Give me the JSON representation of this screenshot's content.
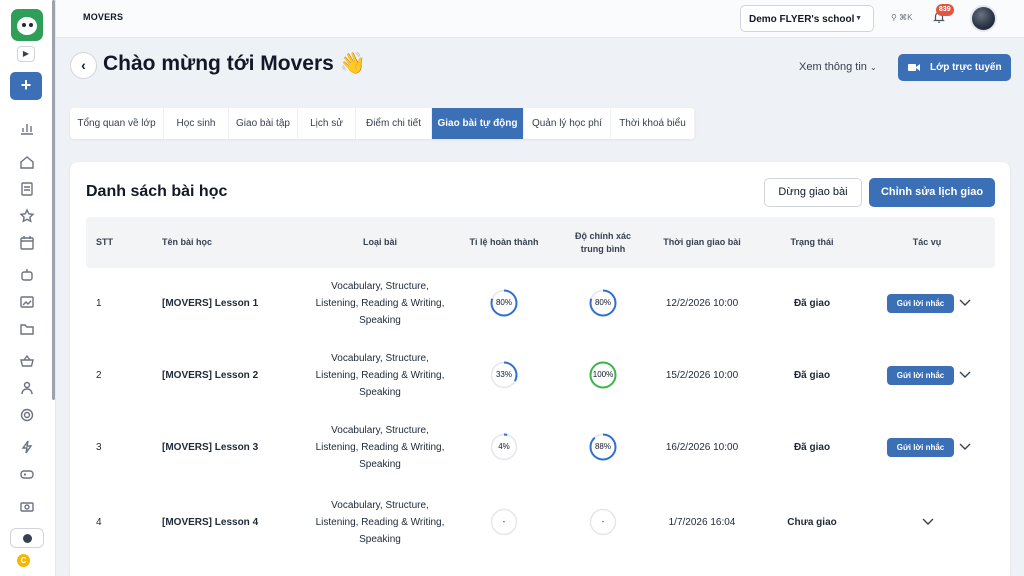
{
  "header": {
    "app_name": "MOVERS",
    "school": "Demo FLYER's school",
    "search_hint": "⌘K",
    "notification_count": "839"
  },
  "page": {
    "title": "Chào mừng tới Movers 👋",
    "info_link": "Xem thông tin",
    "online_class_button": "Lớp trực tuyến"
  },
  "tabs": [
    {
      "label": "Tổng quan về lớp",
      "active": false
    },
    {
      "label": "Học sinh",
      "active": false
    },
    {
      "label": "Giao bài tập",
      "active": false
    },
    {
      "label": "Lịch sử",
      "active": false
    },
    {
      "label": "Điểm chi tiết",
      "active": false
    },
    {
      "label": "Giao bài tự động",
      "active": true
    },
    {
      "label": "Quản lý học phí",
      "active": false
    },
    {
      "label": "Thời khoá biểu",
      "active": false
    }
  ],
  "lessons": {
    "title": "Danh sách bài học",
    "stop_button": "Dừng giao bài",
    "edit_button": "Chỉnh sửa lịch giao",
    "columns": [
      "STT",
      "Tên bài học",
      "Loại bài",
      "Tỉ lệ hoàn thành",
      "Độ chính xác trung bình",
      "Thời gian giao bài",
      "Trạng thái",
      "Tác vụ"
    ],
    "rows": [
      {
        "stt": "1",
        "name": "[MOVERS] Lesson 1",
        "type": "Vocabulary, Structure, Listening, Reading & Writing, Speaking",
        "completion": "80%",
        "completion_value": 0.8,
        "accuracy": "80%",
        "accuracy_value": 0.8,
        "time": "12/2/2026 10:00",
        "status": "Đã giao",
        "action": "Gửi lời nhắc"
      },
      {
        "stt": "2",
        "name": "[MOVERS] Lesson 2",
        "type": "Vocabulary, Structure, Listening, Reading & Writing, Speaking",
        "completion": "33%",
        "completion_value": 0.33,
        "accuracy": "100%",
        "accuracy_value": 1.0,
        "time": "15/2/2026 10:00",
        "status": "Đã giao",
        "action": "Gửi lời nhắc"
      },
      {
        "stt": "3",
        "name": "[MOVERS] Lesson 3",
        "type": "Vocabulary, Structure, Listening, Reading & Writing, Speaking",
        "completion": "4%",
        "completion_value": 0.04,
        "accuracy": "88%",
        "accuracy_value": 0.88,
        "time": "16/2/2026 10:00",
        "status": "Đã giao",
        "action": "Gửi lời nhắc"
      },
      {
        "stt": "4",
        "name": "[MOVERS] Lesson 4",
        "type": "Vocabulary, Structure, Listening, Reading & Writing, Speaking",
        "completion": "-",
        "completion_value": 0,
        "accuracy": "-",
        "accuracy_value": 0,
        "time": "1/7/2026 16:04",
        "status": "Chưa giao",
        "action": ""
      }
    ]
  },
  "colors": {
    "primary": "#3b6fb6",
    "ring_blue": "#2f6fd1",
    "ring_green": "#3bb54a",
    "ring_track": "#e5e7eb"
  }
}
